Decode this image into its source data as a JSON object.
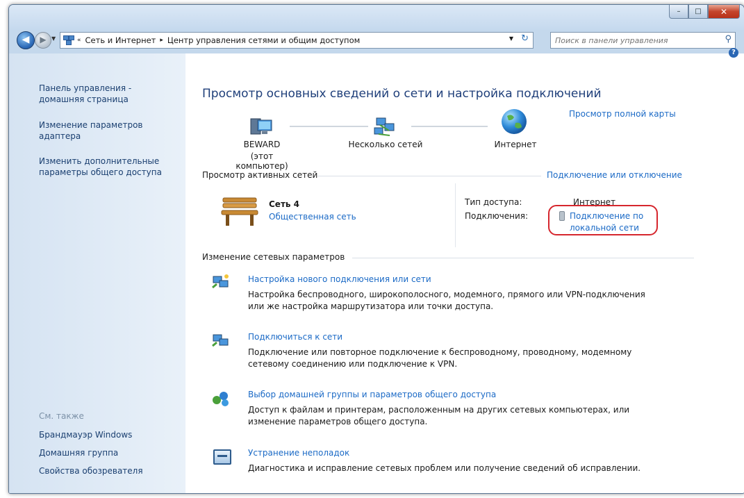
{
  "window": {
    "minimize": "–",
    "maximize": "□",
    "close": "✕"
  },
  "nav": {
    "back": "◀",
    "forward": "▶",
    "breadcrumb_overflow": "«",
    "breadcrumbs": [
      "Сеть и Интернет",
      "Центр управления сетями и общим доступом"
    ],
    "separator": "▸",
    "search_placeholder": "Поиск в панели управления"
  },
  "sidebar": {
    "items": [
      "Панель управления - домашняя страница",
      "Изменение параметров адаптера",
      "Изменить дополнительные параметры общего доступа"
    ],
    "see_also_label": "См. также",
    "see_also": [
      "Брандмауэр Windows",
      "Домашняя группа",
      "Свойства обозревателя"
    ]
  },
  "main": {
    "title": "Просмотр основных сведений о сети и настройка подключений",
    "full_map_link": "Просмотр полной карты",
    "map": {
      "computer_name": "BEWARD",
      "computer_sub": "(этот компьютер)",
      "network": "Несколько сетей",
      "internet": "Интернет"
    },
    "active": {
      "header": "Просмотр активных сетей",
      "connect_link": "Подключение или отключение",
      "network_name": "Сеть 4",
      "network_type": "Общественная сеть",
      "access_label": "Тип доступа:",
      "access_value": "Интернет",
      "connections_label": "Подключения:",
      "connection_line1": "Подключение по",
      "connection_line2": "локальной сети"
    },
    "change": {
      "header": "Изменение сетевых параметров",
      "tasks": [
        {
          "title": "Настройка нового подключения или сети",
          "desc": [
            "Настройка беспроводного, широкополосного, модемного, прямого или VPN-подключения",
            "или же настройка маршрутизатора или точки доступа."
          ],
          "icon": "new-connection-icon"
        },
        {
          "title": "Подключиться к сети",
          "desc": [
            "Подключение или повторное подключение к беспроводному, проводному, модемному",
            "сетевому соединению или подключение к VPN."
          ],
          "icon": "connect-network-icon"
        },
        {
          "title": "Выбор домашней группы и параметров общего доступа",
          "desc": [
            "Доступ к файлам и принтерам, расположенным на других сетевых компьютерах, или",
            "изменение параметров общего доступа."
          ],
          "icon": "homegroup-icon"
        },
        {
          "title": "Устранение неполадок",
          "desc": [
            "Диагностика и исправление сетевых проблем или получение сведений об исправлении."
          ],
          "icon": "troubleshoot-icon"
        }
      ]
    }
  },
  "colors": {
    "accent_link": "#1b6ac6",
    "title_blue": "#1f3f7a",
    "highlight_red": "#d6262d"
  }
}
